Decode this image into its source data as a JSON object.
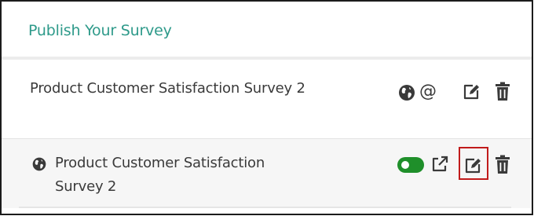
{
  "panel": {
    "title": "Publish Your Survey"
  },
  "rows": [
    {
      "title": "Product Customer Satisfaction Survey 2",
      "actions": [
        "globe-icon",
        "at-sign-icon",
        "edit-icon",
        "trash-icon"
      ],
      "at_symbol": "@"
    },
    {
      "title": "Product Customer Satisfaction Survey 2",
      "status": "published",
      "toggle_on": true,
      "actions": [
        "toggle-switch",
        "external-link-icon",
        "edit-icon",
        "trash-icon"
      ],
      "highlighted_action": "edit-icon"
    }
  ],
  "colors": {
    "title": "#2e9a8a",
    "toggle": "#1f8f2a",
    "highlight": "#c11b1b",
    "icon": "#3a3a3a"
  }
}
